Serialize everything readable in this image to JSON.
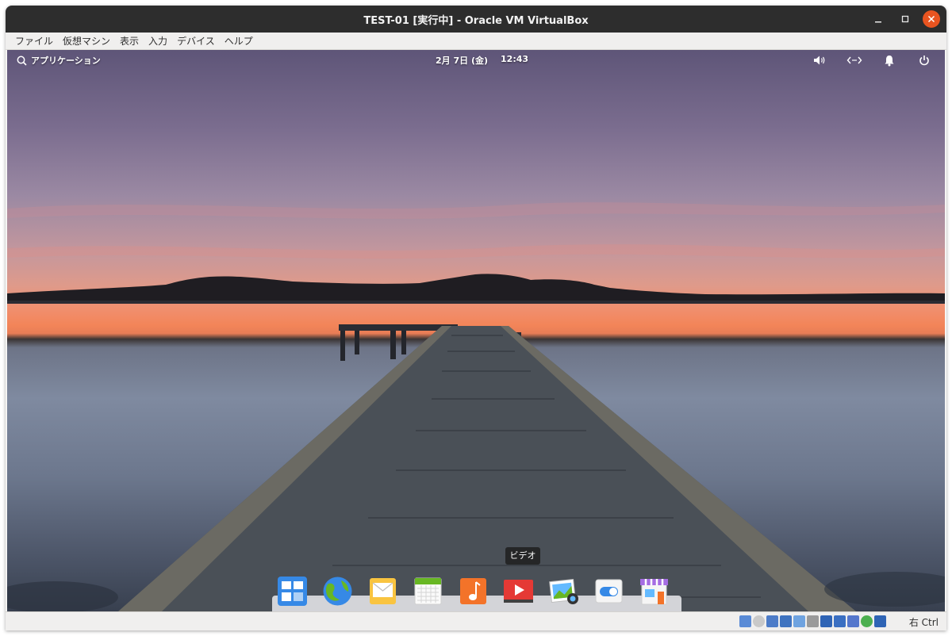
{
  "window": {
    "title": "TEST-01 [実行中] - Oracle VM VirtualBox"
  },
  "menubar": {
    "items": [
      {
        "label": "ファイル"
      },
      {
        "label": "仮想マシン"
      },
      {
        "label": "表示"
      },
      {
        "label": "入力"
      },
      {
        "label": "デバイス"
      },
      {
        "label": "ヘルプ"
      }
    ]
  },
  "guest_panel": {
    "applications_label": "アプリケーション",
    "date": "2月 7日 (金)",
    "time": "12:43",
    "indicators": [
      "volume-icon",
      "network-icon",
      "notifications-icon",
      "power-icon"
    ]
  },
  "dock": {
    "tooltip": "ビデオ",
    "apps": [
      {
        "icon": "multitasking-view-icon"
      },
      {
        "icon": "web-browser-icon"
      },
      {
        "icon": "mail-icon"
      },
      {
        "icon": "calendar-icon"
      },
      {
        "icon": "music-icon"
      },
      {
        "icon": "videos-icon"
      },
      {
        "icon": "photos-icon"
      },
      {
        "icon": "system-settings-icon"
      },
      {
        "icon": "appcenter-icon"
      }
    ]
  },
  "statusbar": {
    "host_key": "右 Ctrl",
    "icons": [
      "hard-disk-icon",
      "optical-drive-icon",
      "audio-icon",
      "network-icon",
      "usb-icon",
      "shared-folders-icon",
      "display-icon",
      "video-capture-icon",
      "virtualization-icon",
      "mouse-integration-icon",
      "keyboard-capture-icon"
    ]
  },
  "colors": {
    "titlebar": "#2d2d2d",
    "close_button": "#e95420",
    "sky_top": "#5e5578",
    "sunset": "#f38559",
    "water": "#7f8aa0"
  }
}
